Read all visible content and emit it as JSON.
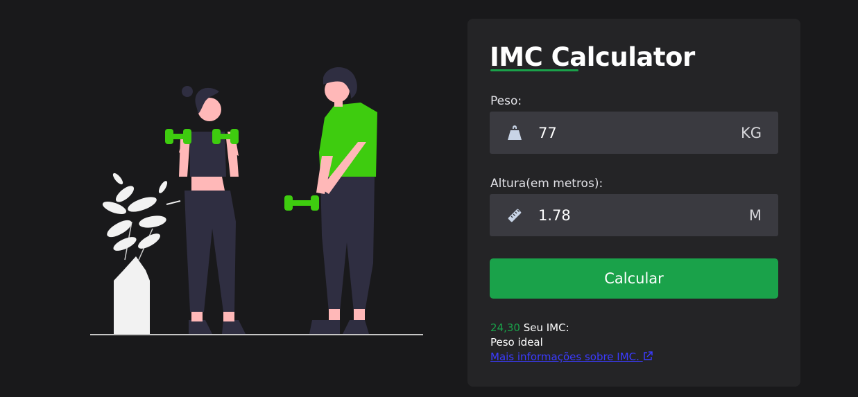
{
  "app": {
    "title": "IMC Calculator"
  },
  "form": {
    "weight_label": "Peso:",
    "weight_value": "77",
    "weight_unit": "KG",
    "height_label": "Altura(em metros):",
    "height_value": "1.78",
    "height_unit": "M",
    "submit_label": "Calcular"
  },
  "result": {
    "imc_value": "24,30",
    "imc_label": "Seu IMC:",
    "status": "Peso ideal",
    "link_text": "Mais informações sobre IMC."
  },
  "colors": {
    "background": "#19191b",
    "card": "#242426",
    "input": "#3a3a40",
    "accent": "#1aa24a",
    "figure_shirt": "#3ecc0f",
    "link": "#3b3bff"
  },
  "icons": [
    "weight-icon",
    "ruler-icon",
    "external-link-icon"
  ]
}
